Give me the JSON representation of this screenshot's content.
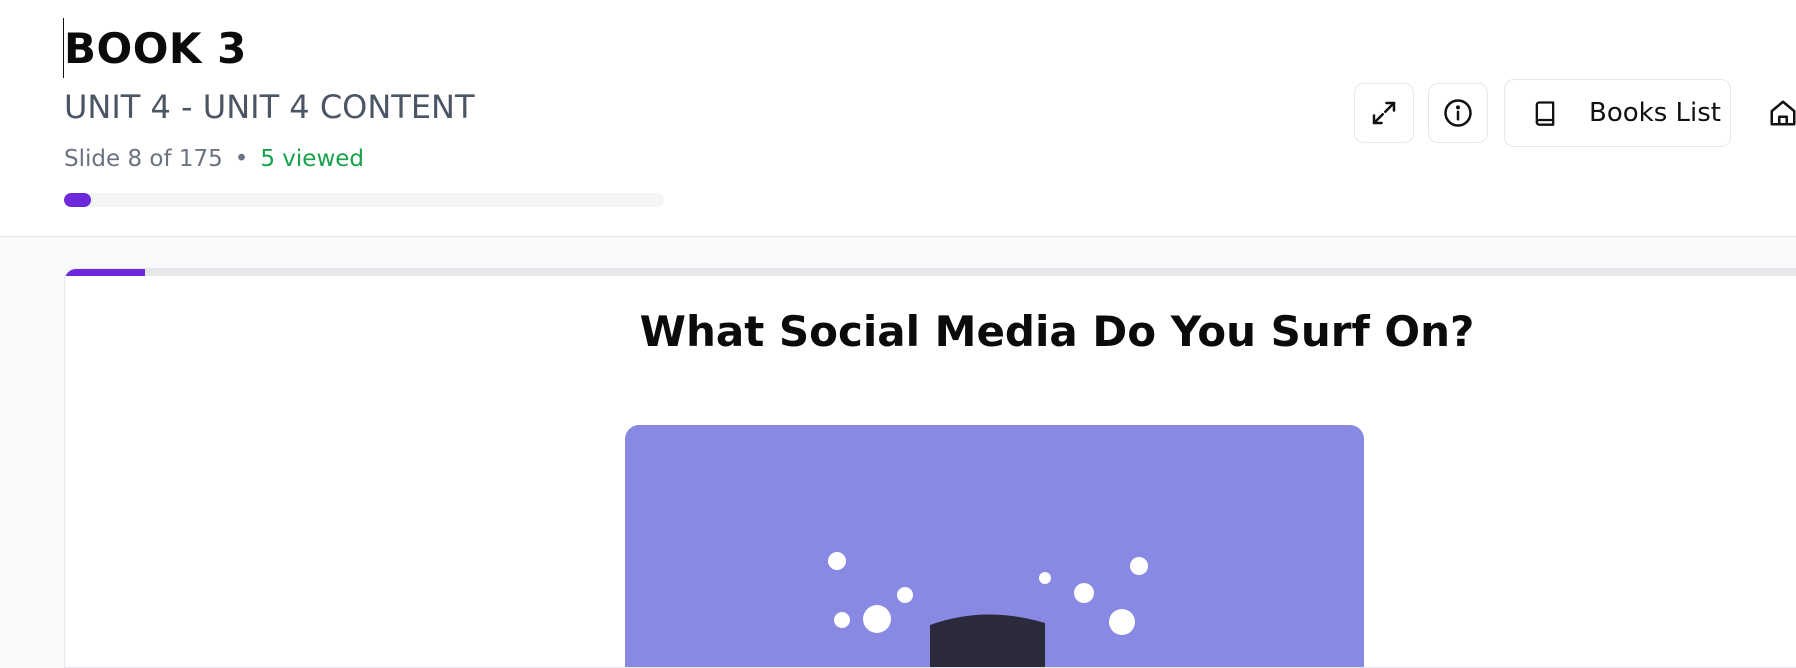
{
  "header": {
    "book_title": "BOOK 3",
    "unit_title": "UNIT 4 - UNIT 4 CONTENT",
    "slide_position": "Slide 8 of 175",
    "separator": "•",
    "viewed": "5 viewed",
    "progress_fraction": 0.0457
  },
  "toolbar": {
    "expand_icon": "expand-icon",
    "info_icon": "info-icon",
    "books_icon": "book-icon",
    "books_label": "Books List",
    "home_icon": "home-icon"
  },
  "slide": {
    "progress_fraction": 0.0457,
    "heading": "What Social Media Do You Surf On?",
    "image_bg": "#8789e3"
  },
  "colors": {
    "accent": "#6d28d9",
    "viewed_green": "#16a34a"
  }
}
